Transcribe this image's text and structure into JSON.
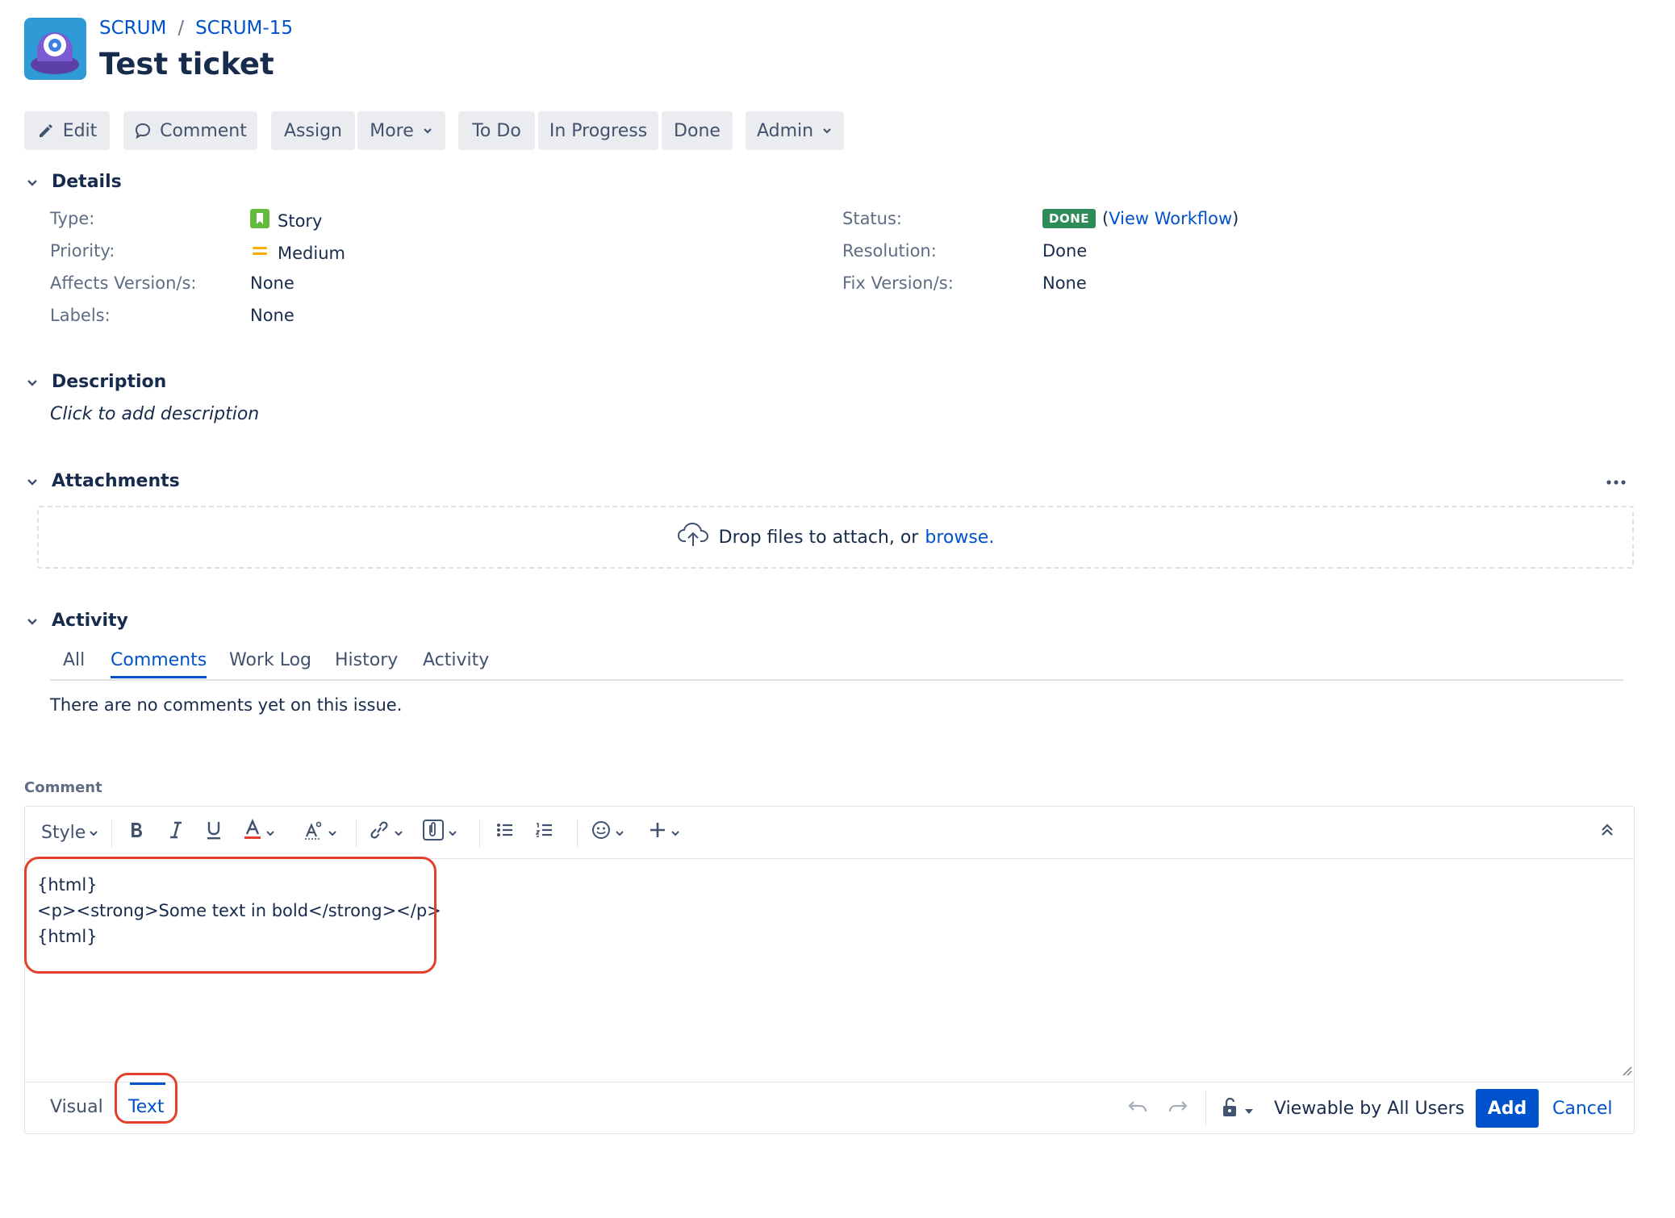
{
  "header": {
    "project": "SCRUM",
    "issue_key": "SCRUM-15",
    "title": "Test ticket",
    "separator": "/"
  },
  "toolbar": {
    "edit": "Edit",
    "comment": "Comment",
    "assign": "Assign",
    "more": "More",
    "todo": "To Do",
    "in_progress": "In Progress",
    "done": "Done",
    "admin": "Admin"
  },
  "details": {
    "heading": "Details",
    "type_label": "Type:",
    "type_value": "Story",
    "priority_label": "Priority:",
    "priority_value": "Medium",
    "affects_label": "Affects Version/s:",
    "affects_value": "None",
    "labels_label": "Labels:",
    "labels_value": "None",
    "status_label": "Status:",
    "status_badge": "DONE",
    "view_workflow_open": "(",
    "view_workflow": "View Workflow",
    "view_workflow_close": ")",
    "resolution_label": "Resolution:",
    "resolution_value": "Done",
    "fix_label": "Fix Version/s:",
    "fix_value": "None"
  },
  "description": {
    "heading": "Description",
    "placeholder": "Click to add description"
  },
  "attachments": {
    "heading": "Attachments",
    "drop_text": "Drop files to attach, or",
    "browse": "browse."
  },
  "activity": {
    "heading": "Activity",
    "tabs": [
      "All",
      "Comments",
      "Work Log",
      "History",
      "Activity"
    ],
    "active_tab": "Comments",
    "empty_message": "There are no comments yet on this issue."
  },
  "comment_editor": {
    "label": "Comment",
    "style_label": "Style",
    "lines": [
      "{html}",
      "<p><strong>Some text in bold</strong></p>",
      "{html}"
    ],
    "mode_visual": "Visual",
    "mode_text": "Text",
    "active_mode": "Text",
    "visibility": "Viewable by All Users",
    "add": "Add",
    "cancel": "Cancel"
  },
  "colors": {
    "link": "#0052cc",
    "done_badge": "#2d8b57",
    "highlight_ring": "#e2402b",
    "toolbar_bg": "#ebecf0"
  }
}
